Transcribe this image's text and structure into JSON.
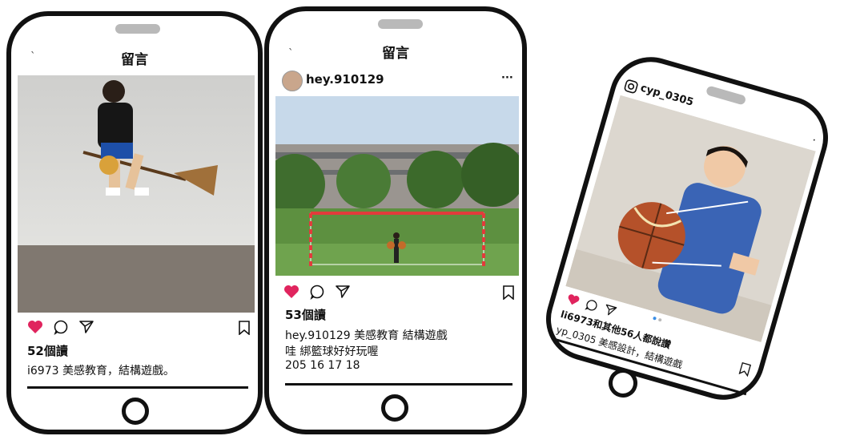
{
  "phones": [
    {
      "header_title": "留言",
      "likes": "52個讀",
      "caption_line1": "i6973 美感教育，結構遊戲。"
    },
    {
      "header_title": "留言",
      "username": "hey.910129",
      "more": "···",
      "likes": "53個讀",
      "caption_line1": "hey.910129 美感教育 結構遊戲",
      "caption_line2": "哇 綁籃球好好玩喔",
      "caption_line3": "205 16 17 18"
    },
    {
      "username": "cyp_0305",
      "likes": "li6973和其他56人都說讚",
      "caption_line1": "yp_0305 美感設計，結構遊戲"
    }
  ],
  "colors": {
    "heart": "#e0245e",
    "frame": "#111111",
    "speaker": "#b9b9b9"
  }
}
